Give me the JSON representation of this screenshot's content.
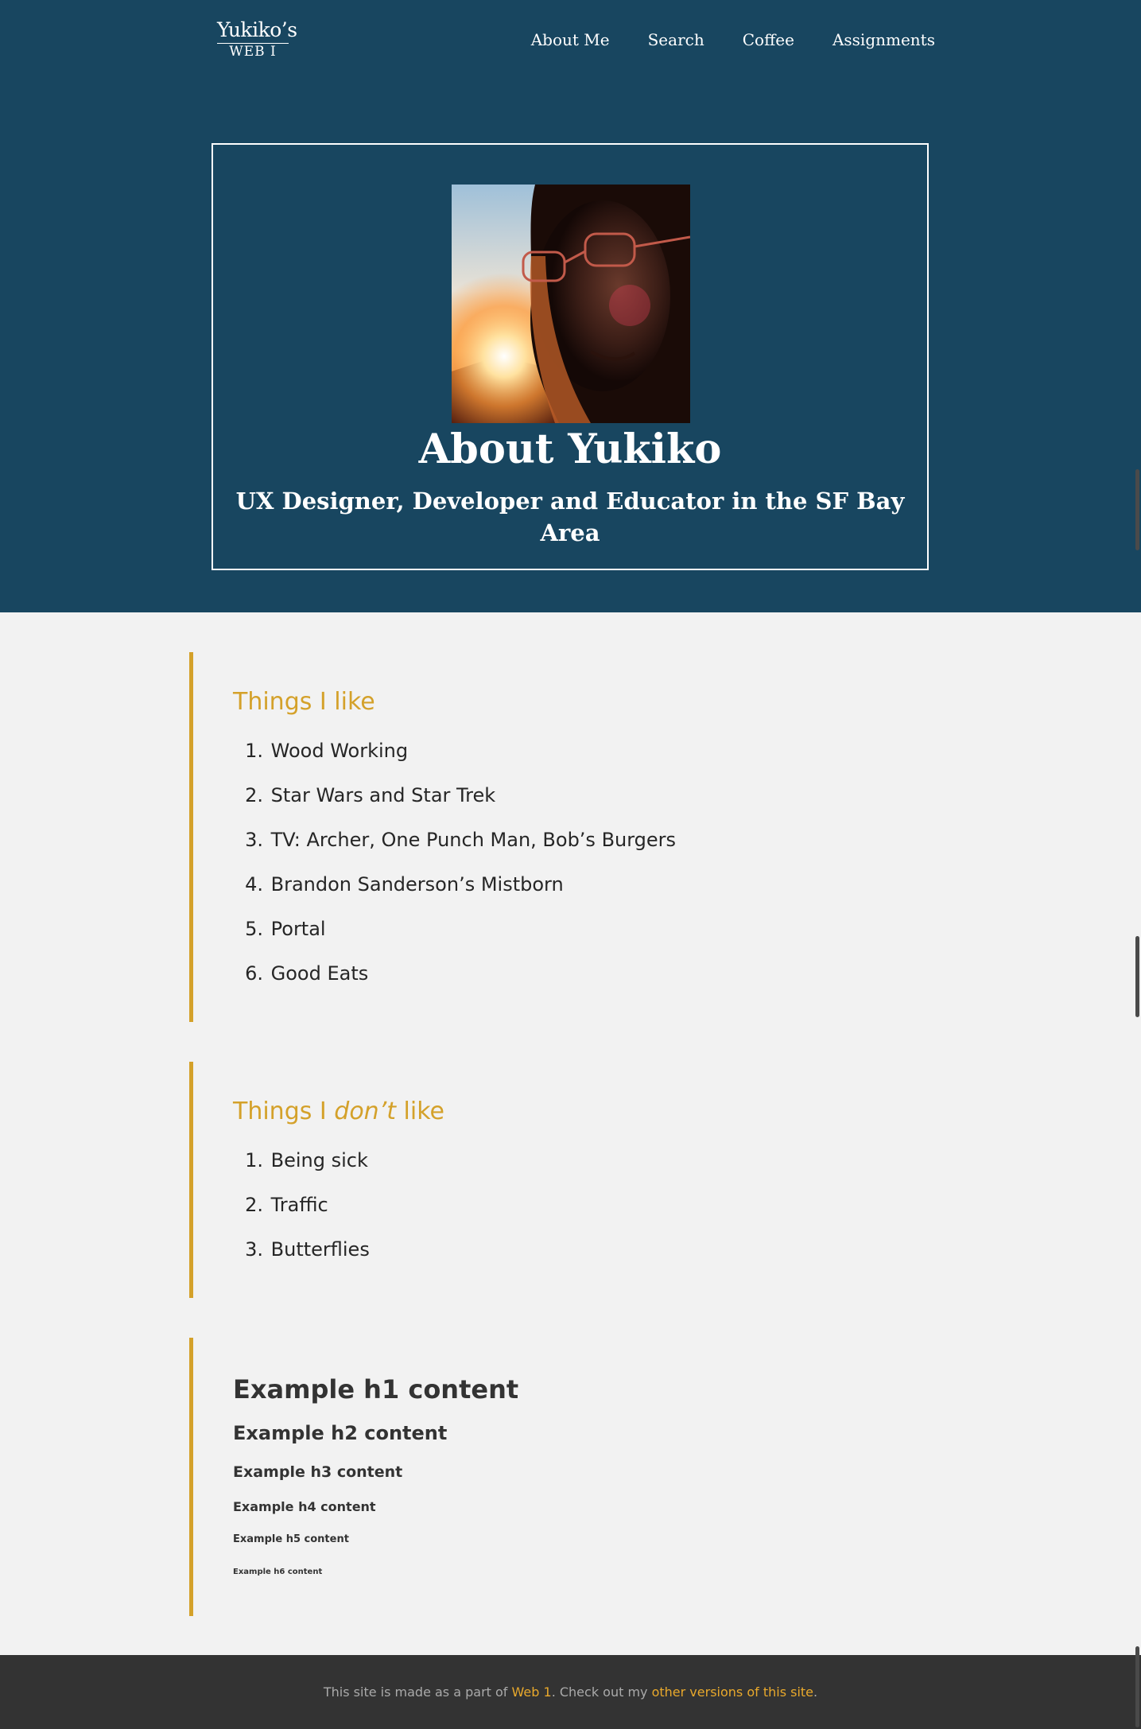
{
  "logo": {
    "line1": "Yukiko’s",
    "line2": "WEB I"
  },
  "nav": {
    "items": [
      "About Me",
      "Search",
      "Coffee",
      "Assignments"
    ]
  },
  "hero": {
    "title": "About Yukiko",
    "subtitle": "UX Designer, Developer and Educator in the SF Bay Area"
  },
  "likes": {
    "heading": "Things I like",
    "items": [
      "Wood Working",
      "Star Wars and Star Trek",
      "TV: Archer, One Punch Man, Bob’s Burgers",
      "Brandon Sanderson’s Mistborn",
      "Portal",
      "Good Eats"
    ]
  },
  "dislikes": {
    "heading_start": "Things I ",
    "heading_em": "don’t",
    "heading_end": " like",
    "items": [
      "Being sick",
      "Traffic",
      "Butterflies"
    ]
  },
  "examples": {
    "h1": "Example h1 content",
    "h2": "Example h2 content",
    "h3": "Example h3 content",
    "h4": "Example h4 content",
    "h5": "Example h5 content",
    "h6": "Example h6 content"
  },
  "footer": {
    "text1": "This site is made as a part of ",
    "link1": "Web 1",
    "text2": ". Check out my ",
    "link2": "other versions of this site",
    "text3": "."
  },
  "colors": {
    "hero_bg": "#184660",
    "accent": "#d4a12a",
    "footer_bg": "#333333",
    "footer_link": "#e9a92c",
    "page_bg": "#f2f2f2"
  }
}
